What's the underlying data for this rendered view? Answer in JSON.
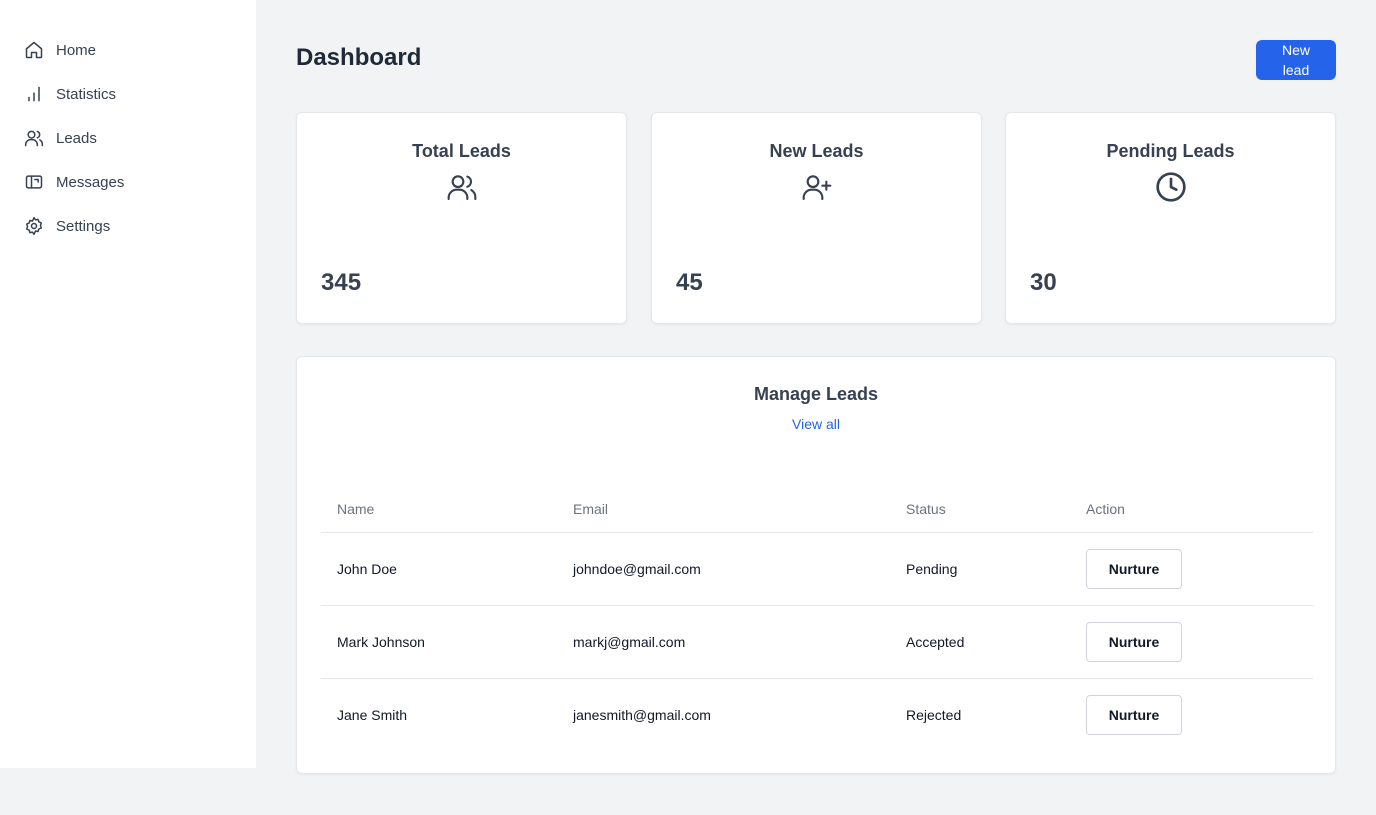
{
  "sidebar": {
    "items": [
      {
        "label": "Home",
        "icon": "home-icon"
      },
      {
        "label": "Statistics",
        "icon": "bar-chart-icon"
      },
      {
        "label": "Leads",
        "icon": "users-icon"
      },
      {
        "label": "Messages",
        "icon": "message-box-icon"
      },
      {
        "label": "Settings",
        "icon": "gear-icon"
      }
    ]
  },
  "header": {
    "title": "Dashboard",
    "new_lead_label": "New lead"
  },
  "cards": [
    {
      "title": "Total Leads",
      "icon": "users-icon",
      "value": "345"
    },
    {
      "title": "New Leads",
      "icon": "user-plus-icon",
      "value": "45"
    },
    {
      "title": "Pending Leads",
      "icon": "clock-icon",
      "value": "30"
    }
  ],
  "manage_leads": {
    "title": "Manage Leads",
    "view_all_label": "View all",
    "columns": [
      "Name",
      "Email",
      "Status",
      "Action"
    ],
    "rows": [
      {
        "name": "John Doe",
        "email": "johndoe@gmail.com",
        "status": "Pending",
        "action": "Nurture"
      },
      {
        "name": "Mark Johnson",
        "email": "markj@gmail.com",
        "status": "Accepted",
        "action": "Nurture"
      },
      {
        "name": "Jane Smith",
        "email": "janesmith@gmail.com",
        "status": "Rejected",
        "action": "Nurture"
      }
    ]
  },
  "colors": {
    "accent": "#2563eb",
    "background": "#f2f3f5",
    "card": "#ffffff"
  }
}
